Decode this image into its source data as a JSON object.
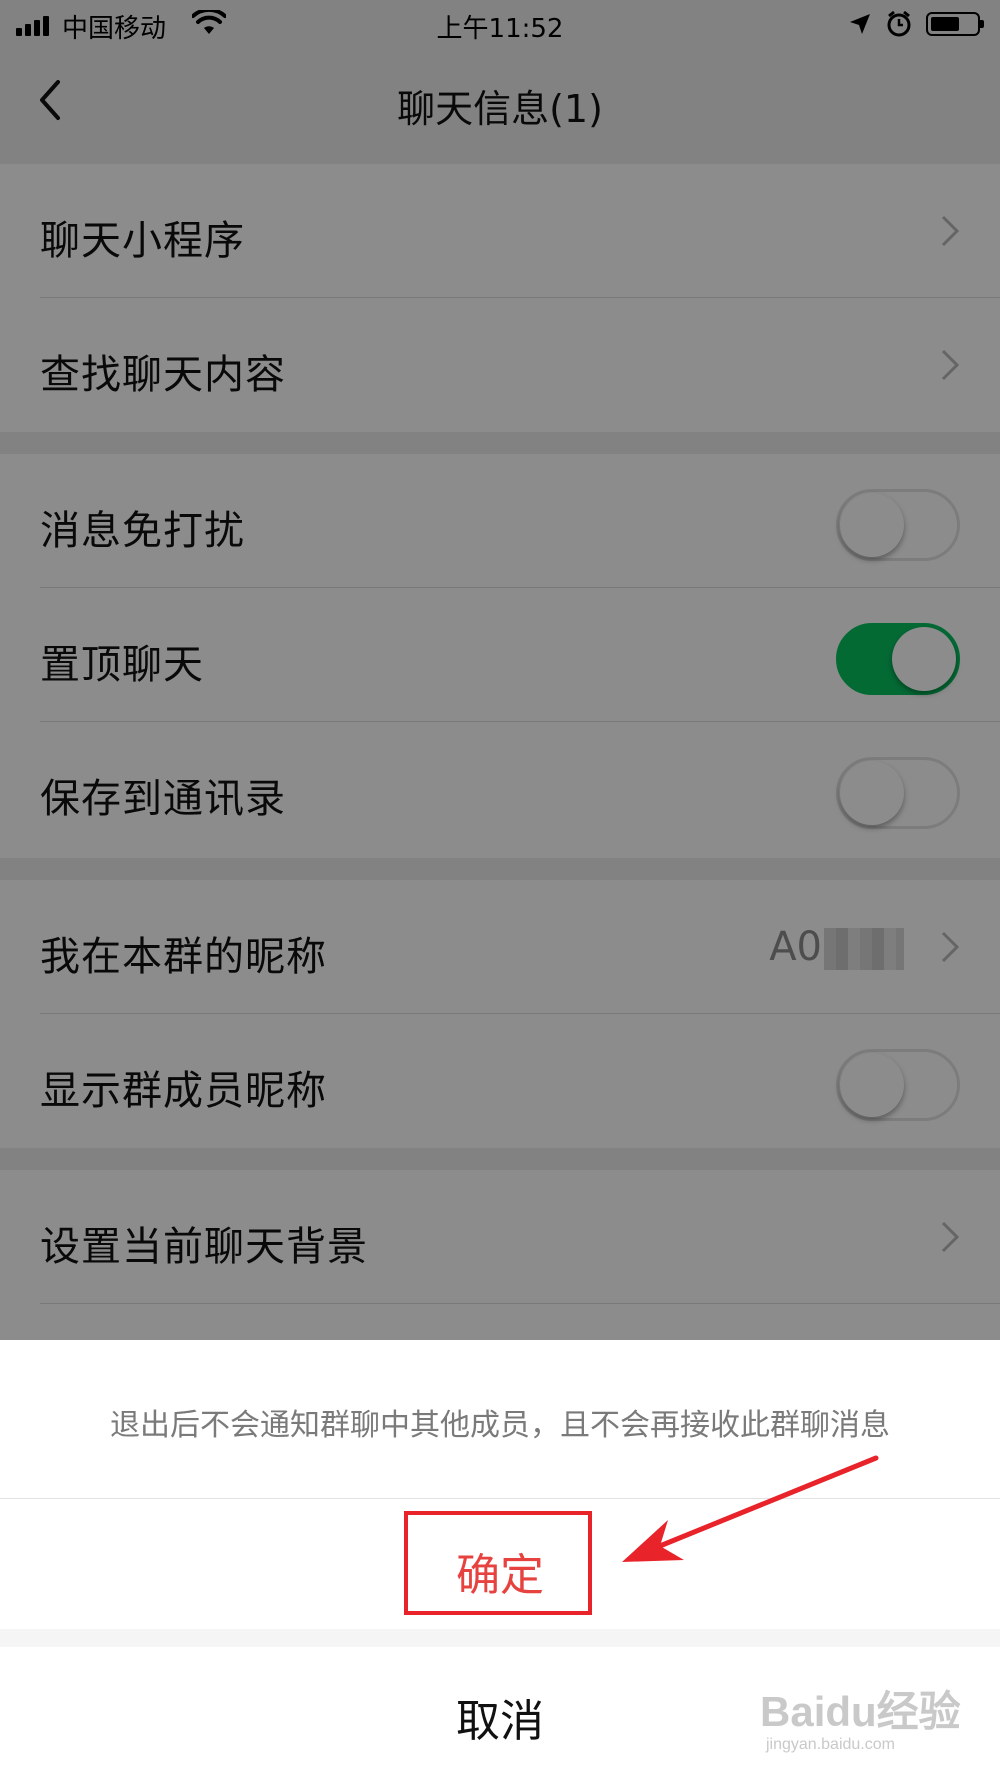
{
  "status_bar": {
    "carrier": "中国移动",
    "time": "上午11:52"
  },
  "nav": {
    "title": "聊天信息(1)",
    "back_icon": "chevron-left-icon"
  },
  "sections": [
    {
      "rows": [
        {
          "label": "聊天小程序",
          "type": "link"
        },
        {
          "label": "查找聊天内容",
          "type": "link"
        }
      ]
    },
    {
      "rows": [
        {
          "label": "消息免打扰",
          "type": "toggle",
          "on": false
        },
        {
          "label": "置顶聊天",
          "type": "toggle",
          "on": true
        },
        {
          "label": "保存到通讯录",
          "type": "toggle",
          "on": false
        }
      ]
    },
    {
      "rows": [
        {
          "label": "我在本群的昵称",
          "type": "link",
          "value": "A0"
        },
        {
          "label": "显示群成员昵称",
          "type": "toggle",
          "on": false
        }
      ]
    },
    {
      "rows": [
        {
          "label": "设置当前聊天背景",
          "type": "link"
        }
      ]
    }
  ],
  "action_sheet": {
    "message": "退出后不会通知群聊中其他成员，且不会再接收此群聊消息",
    "confirm": "确定",
    "cancel": "取消"
  },
  "watermark": {
    "brand": "Baidu经验",
    "url": "jingyan.baidu.com"
  },
  "colors": {
    "accent_green": "#07c160",
    "destructive_red": "#e64340",
    "annotation_red": "#e8232a"
  }
}
